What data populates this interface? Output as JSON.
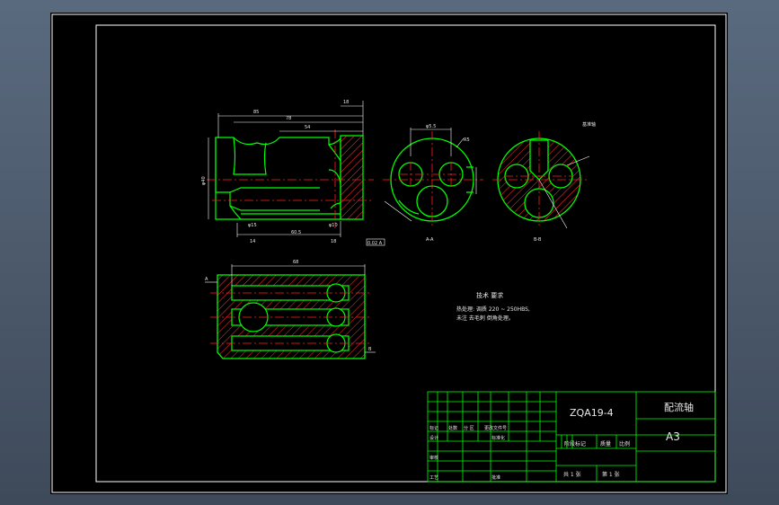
{
  "drawing": {
    "background": "#000000",
    "frame_color": "#ffffff",
    "line_color": "#00ff00",
    "centerline_color": "#ff2020",
    "hatch_color": "#ff3030"
  },
  "title_block": {
    "drawing_number": "ZQA19-4",
    "part_name": "配流轴",
    "sheet_size": "A3",
    "marks_label": "阶段标记",
    "weight_label": "质量",
    "scale_label": "比例",
    "total_sheets": "共 1 张",
    "sheet_no": "第 1 张",
    "row_labels": [
      "标记",
      "设计",
      "审核",
      "工艺"
    ],
    "col_labels": [
      "处数",
      "分 区",
      "更改文件号",
      "签名",
      "年月日"
    ],
    "std_label": "标准化",
    "approve_label": "批准"
  },
  "notes": {
    "heading": "技术 要求",
    "line1": "热处理: 调质 220 ~ 250HBS,",
    "line2": "未注 去毛刺 倒角处理。"
  },
  "views": {
    "side_label": "A-A",
    "section_label": "B-B",
    "detail_label": "基准轴"
  },
  "dimensions": {
    "overall": "85",
    "d1": "78",
    "d2": "54",
    "d3": "18",
    "d4": "14",
    "dia_main": "φ40",
    "dia_small": "φ15",
    "dia_10": "φ10",
    "len_605": "60.5",
    "len_14": "14",
    "len_18": "18",
    "chord": "φ5.5",
    "r": "R5",
    "cut_label": "A",
    "sec_label": "B",
    "tol_box": "0.02 A",
    "sec_len": "68"
  }
}
